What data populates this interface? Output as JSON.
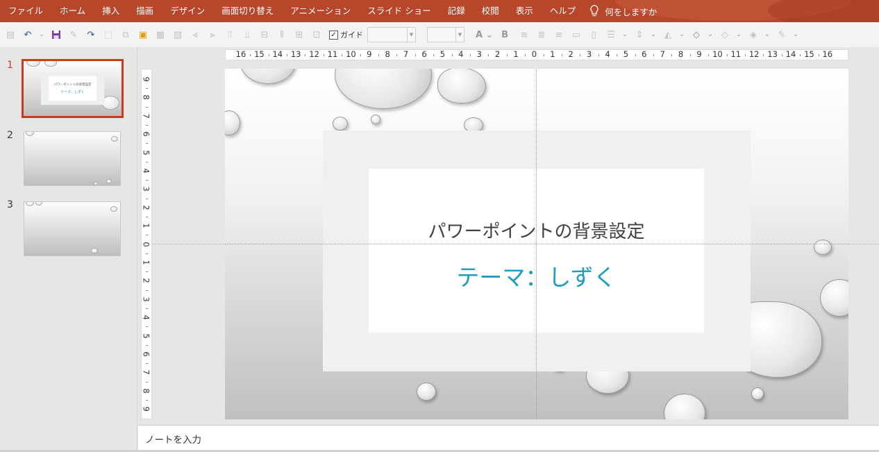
{
  "ribbon": {
    "tabs": [
      "ファイル",
      "ホーム",
      "挿入",
      "描画",
      "デザイン",
      "画面切り替え",
      "アニメーション",
      "スライド ショー",
      "記録",
      "校閲",
      "表示",
      "ヘルプ"
    ],
    "tell_me": "何をしますか",
    "accent_color": "#b7472a"
  },
  "toolbar": {
    "guide_label": "ガイド",
    "guide_checked": true,
    "font_button": "A",
    "bold_button": "B"
  },
  "thumbnails": [
    {
      "number": "1",
      "selected": true,
      "title": "パワーポイントの背景設定",
      "subtitle": "テーマ：しずく"
    },
    {
      "number": "2",
      "selected": false
    },
    {
      "number": "3",
      "selected": false
    }
  ],
  "rulers": {
    "horizontal": [
      "16",
      "15",
      "14",
      "13",
      "12",
      "11",
      "10",
      "9",
      "8",
      "7",
      "6",
      "5",
      "4",
      "3",
      "2",
      "1",
      "0",
      "1",
      "2",
      "3",
      "4",
      "5",
      "6",
      "7",
      "8",
      "9",
      "10",
      "11",
      "12",
      "13",
      "14",
      "15",
      "16"
    ],
    "vertical": [
      "9",
      "8",
      "7",
      "6",
      "5",
      "4",
      "3",
      "2",
      "1",
      "0",
      "1",
      "2",
      "3",
      "4",
      "5",
      "6",
      "7",
      "8",
      "9"
    ]
  },
  "slide": {
    "title": "パワーポイントの背景設定",
    "subtitle": "テーマ：しずく",
    "title_color": "#404040",
    "subtitle_color": "#1e9dc2"
  },
  "notes": {
    "placeholder": "ノートを入力"
  }
}
